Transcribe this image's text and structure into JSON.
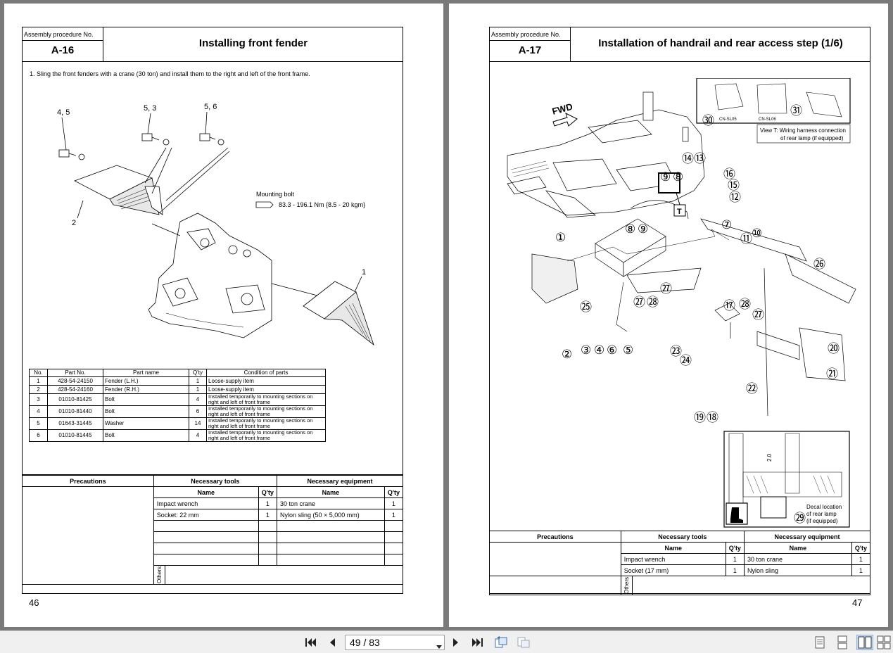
{
  "left_page": {
    "assembly_label": "Assembly procedure No.",
    "procedure_no": "A-16",
    "title": "Installing front fender",
    "instruction": "1.   Sling the front fenders with a crane (30 ton) and install them to the right and left of the front frame.",
    "callouts": {
      "c45": "4, 5",
      "c53": "5, 3",
      "c56": "5, 6",
      "c2": "2",
      "c1": "1"
    },
    "mounting_bolt_label": "Mounting bolt",
    "mounting_bolt_torque": "83.3 - 196.1 Nm {8.5 - 20 kgm}",
    "parts_headers": [
      "No.",
      "Part No.",
      "Part name",
      "Q'ty",
      "Condition of parts"
    ],
    "parts": [
      {
        "no": "1",
        "part_no": "428-54-24150",
        "name": "Fender (L.H.)",
        "qty": "1",
        "cond": "Loose-supply item"
      },
      {
        "no": "2",
        "part_no": "428-54-24160",
        "name": "Fender (R.H.)",
        "qty": "1",
        "cond": "Loose-supply item"
      },
      {
        "no": "3",
        "part_no": "01010-81425",
        "name": "Bolt",
        "qty": "4",
        "cond": "Installed temporarily to mounting sections on right and left of front frame"
      },
      {
        "no": "4",
        "part_no": "01010-81440",
        "name": "Bolt",
        "qty": "6",
        "cond": "Installed temporarily to mounting sections on right and left of front frame"
      },
      {
        "no": "5",
        "part_no": "01643-31445",
        "name": "Washer",
        "qty": "14",
        "cond": "Installed temporarily to mounting sections on right and left of front frame"
      },
      {
        "no": "6",
        "part_no": "01010-81445",
        "name": "Bolt",
        "qty": "4",
        "cond": "Installed temporarily to mounting sections on right and left of front frame"
      }
    ],
    "precautions": "Precautions",
    "necessary_tools": "Necessary tools",
    "necessary_equipment": "Necessary equipment",
    "col_name": "Name",
    "col_qty": "Q'ty",
    "tools": [
      {
        "name": "Impact wrench",
        "qty": "1"
      },
      {
        "name": "Socket: 22 mm",
        "qty": "1"
      }
    ],
    "equipment": [
      {
        "name": "30 ton crane",
        "qty": "1"
      },
      {
        "name": "Nylon sling (50 × 5,000 mm)",
        "qty": "1"
      }
    ],
    "others": "Others",
    "page_number": "46"
  },
  "right_page": {
    "assembly_label": "Assembly procedure No.",
    "procedure_no": "A-17",
    "title": "Installation of handrail and rear access step (1/6)",
    "fwd_label": "FWD",
    "view_t_caption_1": "View T: Wiring harness connection",
    "view_t_caption_2": "of rear lamp (if equipped)",
    "connector_a": "CN-SL05",
    "connector_b": "CN-SL06",
    "t_label": "T",
    "dim_label": "2.0",
    "decal_caption_1": "Decal location",
    "decal_caption_2": "of rear lamp",
    "decal_caption_3": "(if equipped)",
    "callouts": [
      "①",
      "②",
      "③",
      "④",
      "⑤",
      "⑥",
      "⑦",
      "⑧",
      "⑨",
      "⑩",
      "⑪",
      "⑫",
      "⑬",
      "⑭",
      "⑮",
      "⑯",
      "⑰",
      "⑱",
      "⑲",
      "⑳",
      "㉑",
      "㉒",
      "㉓",
      "㉔",
      "㉕",
      "㉖",
      "㉗",
      "㉘",
      "㉙",
      "㉚",
      "㉛"
    ],
    "precautions": "Precautions",
    "necessary_tools": "Necessary tools",
    "necessary_equipment": "Necessary equipment",
    "col_name": "Name",
    "col_qty": "Q'ty",
    "tools": [
      {
        "name": "Impact wrench",
        "qty": "1"
      },
      {
        "name": "Socket (17 mm)",
        "qty": "1"
      }
    ],
    "equipment": [
      {
        "name": "30 ton crane",
        "qty": "1"
      },
      {
        "name": "Nylon sling",
        "qty": "1"
      }
    ],
    "others": "Others",
    "page_number": "47"
  },
  "toolbar": {
    "page_value": "49 / 83",
    "icons": [
      "first-page-icon",
      "prev-page-icon",
      "next-page-icon",
      "last-page-icon",
      "rotate-icon",
      "copy-icon",
      "single-page-view-icon",
      "continuous-view-icon",
      "two-page-view-icon",
      "two-page-continuous-icon"
    ]
  }
}
